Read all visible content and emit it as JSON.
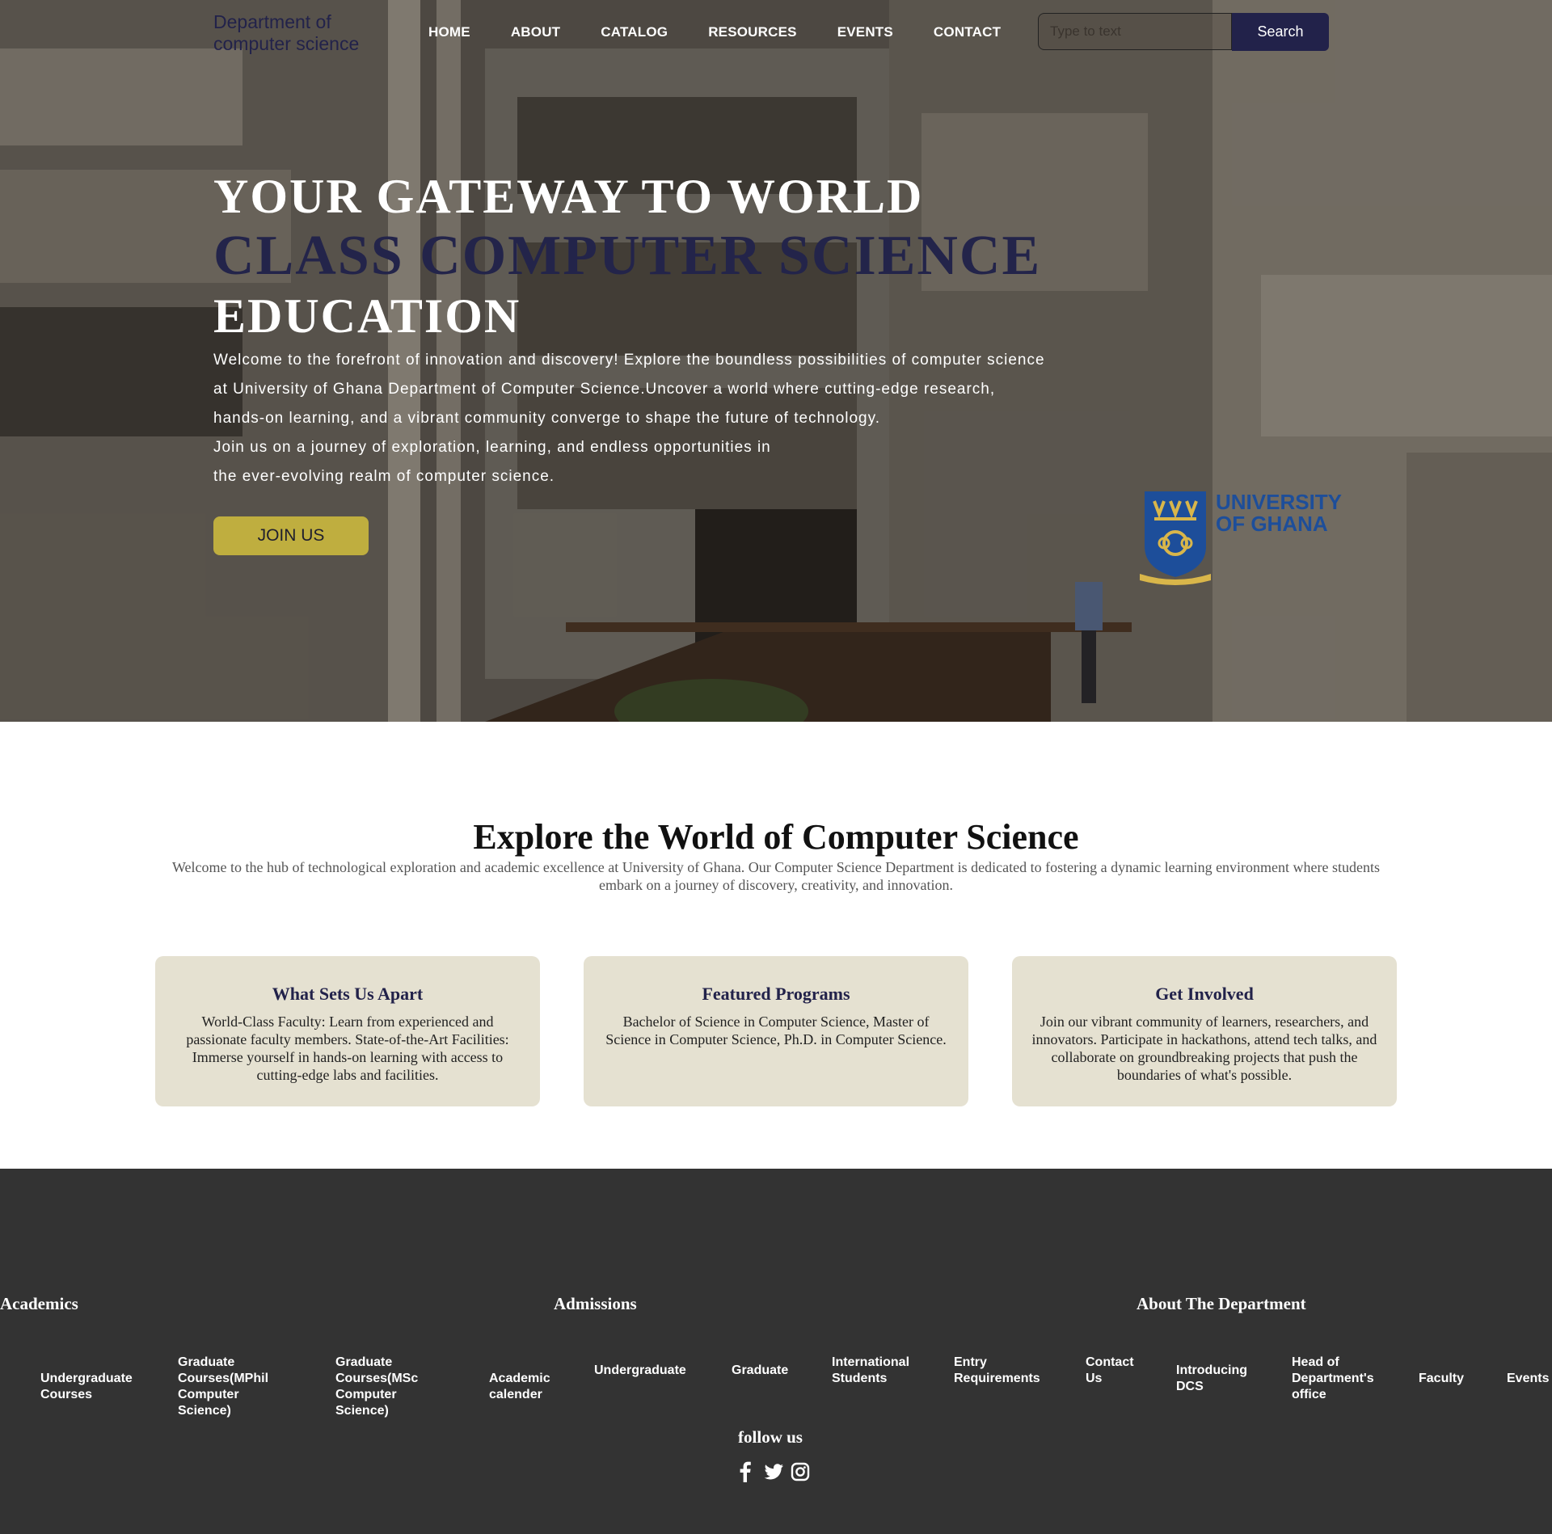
{
  "nav": {
    "brand": "Department of computer science",
    "links": [
      "HOME",
      "ABOUT",
      "CATALOG",
      "RESOURCES",
      "EVENTS",
      "CONTACT"
    ],
    "search_placeholder": "Type to text",
    "search_button": "Search"
  },
  "hero": {
    "title_line1": "YOUR GATEWAY TO WORLD",
    "title_line2": "CLASS COMPUTER SCIENCE",
    "title_line3": "EDUCATION",
    "text_lines": [
      "Welcome to the forefront of innovation and discovery! Explore the boundless possibilities of computer science",
      "at University of Ghana Department of Computer Science.Uncover a world where cutting-edge research,",
      "hands-on learning, and a vibrant community converge to shape the future of technology.",
      "Join us on a journey of exploration, learning, and endless opportunities in",
      "the ever-evolving realm of computer science."
    ],
    "join_button": "JOIN US",
    "logo_text_line1": "UNIVERSITY",
    "logo_text_line2": "OF GHANA"
  },
  "explore": {
    "title": "Explore the World of Computer Science",
    "subtitle": "Welcome to the hub of technological exploration and academic excellence at University of Ghana. Our Computer Science Department is dedicated to fostering a dynamic learning environment where students embark on a journey of discovery, creativity, and innovation."
  },
  "cards": [
    {
      "title": "What Sets Us Apart",
      "text": "World-Class Faculty: Learn from experienced and passionate faculty members. State-of-the-Art Facilities: Immerse yourself in hands-on learning with access to cutting-edge labs and facilities."
    },
    {
      "title": "Featured Programs",
      "text": "Bachelor of Science in Computer Science, Master of Science in Computer Science, Ph.D. in Computer Science."
    },
    {
      "title": "Get Involved",
      "text": "Join our vibrant community of learners, researchers, and innovators. Participate in hackathons, attend tech talks, and collaborate on groundbreaking projects that push the boundaries of what's possible."
    }
  ],
  "footer": {
    "headings": [
      "Academics",
      "Admissions",
      "About The Department"
    ],
    "academics": [
      "Undergraduate Courses",
      "Graduate Courses(MPhil Computer Science)",
      "Graduate Courses(MSc Computer Science)",
      "Academic calender"
    ],
    "admissions": [
      "Undergraduate",
      "Graduate",
      "International Students",
      "Entry Requirements",
      "Contact Us"
    ],
    "about": [
      "Introducing DCS",
      "Head of Department's office",
      "Faculty",
      "Events"
    ],
    "follow": "follow us",
    "social_icons": [
      "facebook-icon",
      "twitter-icon",
      "instagram-icon"
    ]
  },
  "colors": {
    "navy": "#22224a",
    "gold": "#bfae3f",
    "card_bg": "#e5e1d1",
    "footer_bg": "#333333",
    "ug_blue": "#1d4e9a"
  }
}
